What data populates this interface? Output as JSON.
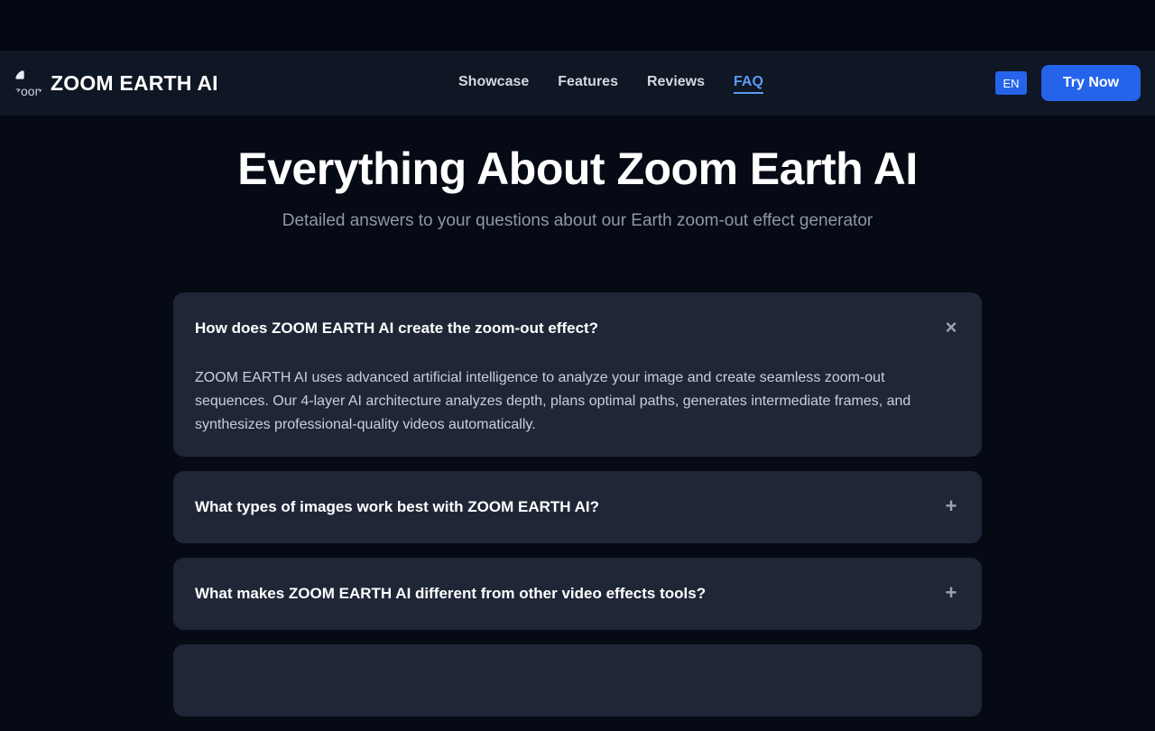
{
  "brand": {
    "name": "ZOOM EARTH AI",
    "logo_alt": "zoom"
  },
  "nav": {
    "links": [
      {
        "label": "Showcase"
      },
      {
        "label": "Features"
      },
      {
        "label": "Reviews"
      },
      {
        "label": "FAQ",
        "active": true
      }
    ],
    "lang": "EN",
    "cta": "Try Now"
  },
  "hero": {
    "title": "Everything About Zoom Earth AI",
    "subtitle": "Detailed answers to your questions about our Earth zoom-out effect generator"
  },
  "faq": [
    {
      "question": "How does ZOOM EARTH AI create the zoom-out effect?",
      "answer": "ZOOM EARTH AI uses advanced artificial intelligence to analyze your image and create seamless zoom-out sequences. Our 4-layer AI architecture analyzes depth, plans optimal paths, generates intermediate frames, and synthesizes professional-quality videos automatically.",
      "open": true,
      "toggle": "×"
    },
    {
      "question": "What types of images work best with ZOOM EARTH AI?",
      "open": false,
      "toggle": "+"
    },
    {
      "question": "What makes ZOOM EARTH AI different from other video effects tools?",
      "open": false,
      "toggle": "+"
    }
  ],
  "colors": {
    "accent": "#2563eb",
    "link_active": "#5b9bf5",
    "card": "#1f2737",
    "background": "#050a14"
  }
}
